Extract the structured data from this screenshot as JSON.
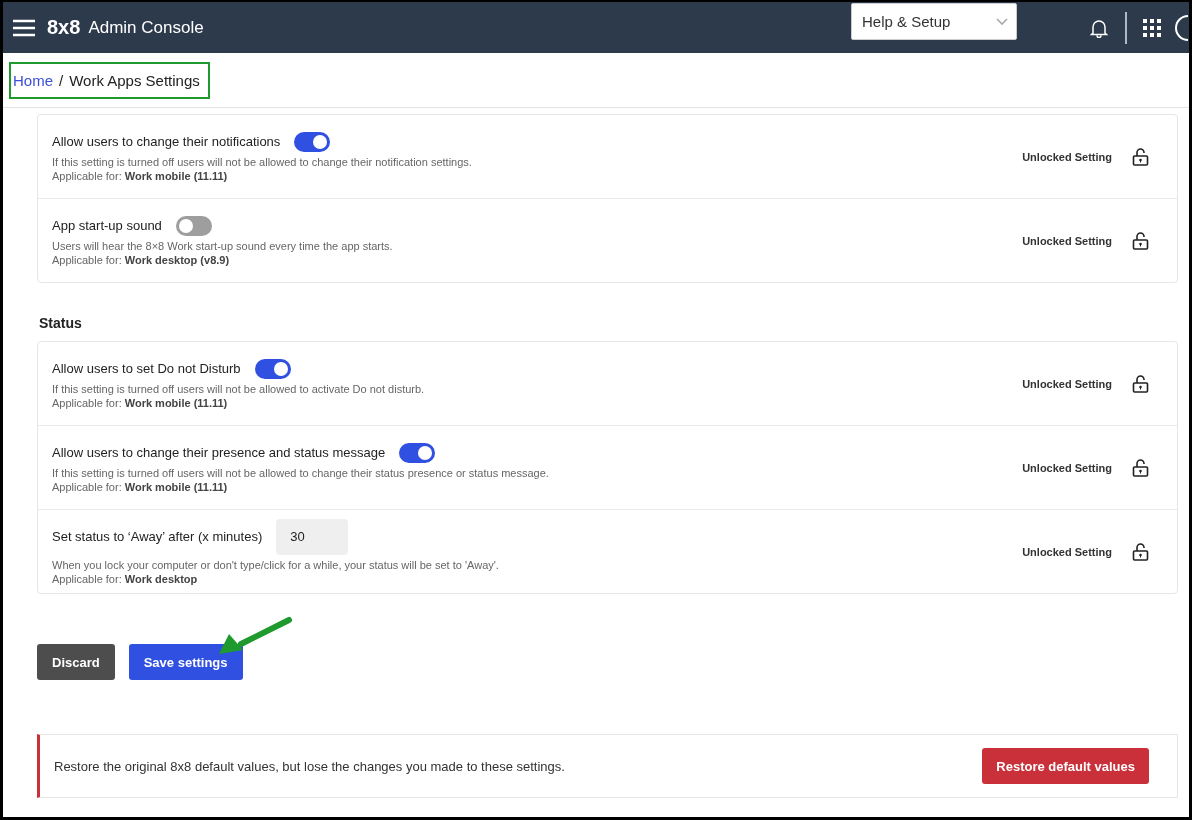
{
  "header": {
    "logo": "8x8",
    "title": "Admin Console",
    "help_dropdown": "Help & Setup"
  },
  "breadcrumb": [
    {
      "label": "Home",
      "link": true
    },
    {
      "label": "/",
      "link": false
    },
    {
      "label": "Work Apps Settings",
      "link": false
    }
  ],
  "sections": [
    {
      "settings": [
        {
          "kind": "toggle",
          "label": "Allow users to change their notifications",
          "on": true,
          "description": "If this setting is turned off users will not be allowed to change their notification settings.",
          "applicable": "Applicable for: **Work mobile (11.11)**",
          "lock_label": "Unlocked Setting"
        },
        {
          "kind": "toggle",
          "label": "App start-up sound",
          "on": false,
          "description": "Users will hear the 8×8 Work start-up sound every time the app starts.",
          "applicable": "Applicable for: **Work desktop (v8.9)**",
          "lock_label": "Unlocked Setting"
        }
      ]
    },
    {
      "heading": "Status",
      "settings": [
        {
          "kind": "toggle",
          "label": "Allow users to set Do not Disturb",
          "on": true,
          "description": "If this setting is turned off users will not be allowed to activate Do not disturb.",
          "applicable": "Applicable for: **Work mobile (11.11)**",
          "lock_label": "Unlocked Setting"
        },
        {
          "kind": "toggle",
          "label": "Allow users to change their presence and status message",
          "on": true,
          "description": "If this setting is turned off users will not be allowed to change their status presence or status message.",
          "applicable": "Applicable for: **Work mobile (11.11)**",
          "lock_label": "Unlocked Setting"
        },
        {
          "kind": "number",
          "label": "Set status to ‘Away’ after (x minutes)",
          "value": "30",
          "description": "When you lock your computer or don't type/click for a while, your status will be set to 'Away'.",
          "applicable": "Applicable for: **Work desktop**",
          "lock_label": "Unlocked Setting"
        }
      ]
    }
  ],
  "actions": [
    {
      "label": "Discard",
      "kind": "secondary"
    },
    {
      "label": "Save settings",
      "kind": "primary"
    }
  ],
  "restore": {
    "text": "Restore the original 8x8 default values, but lose the changes you made to these settings.",
    "button": "Restore default values"
  }
}
